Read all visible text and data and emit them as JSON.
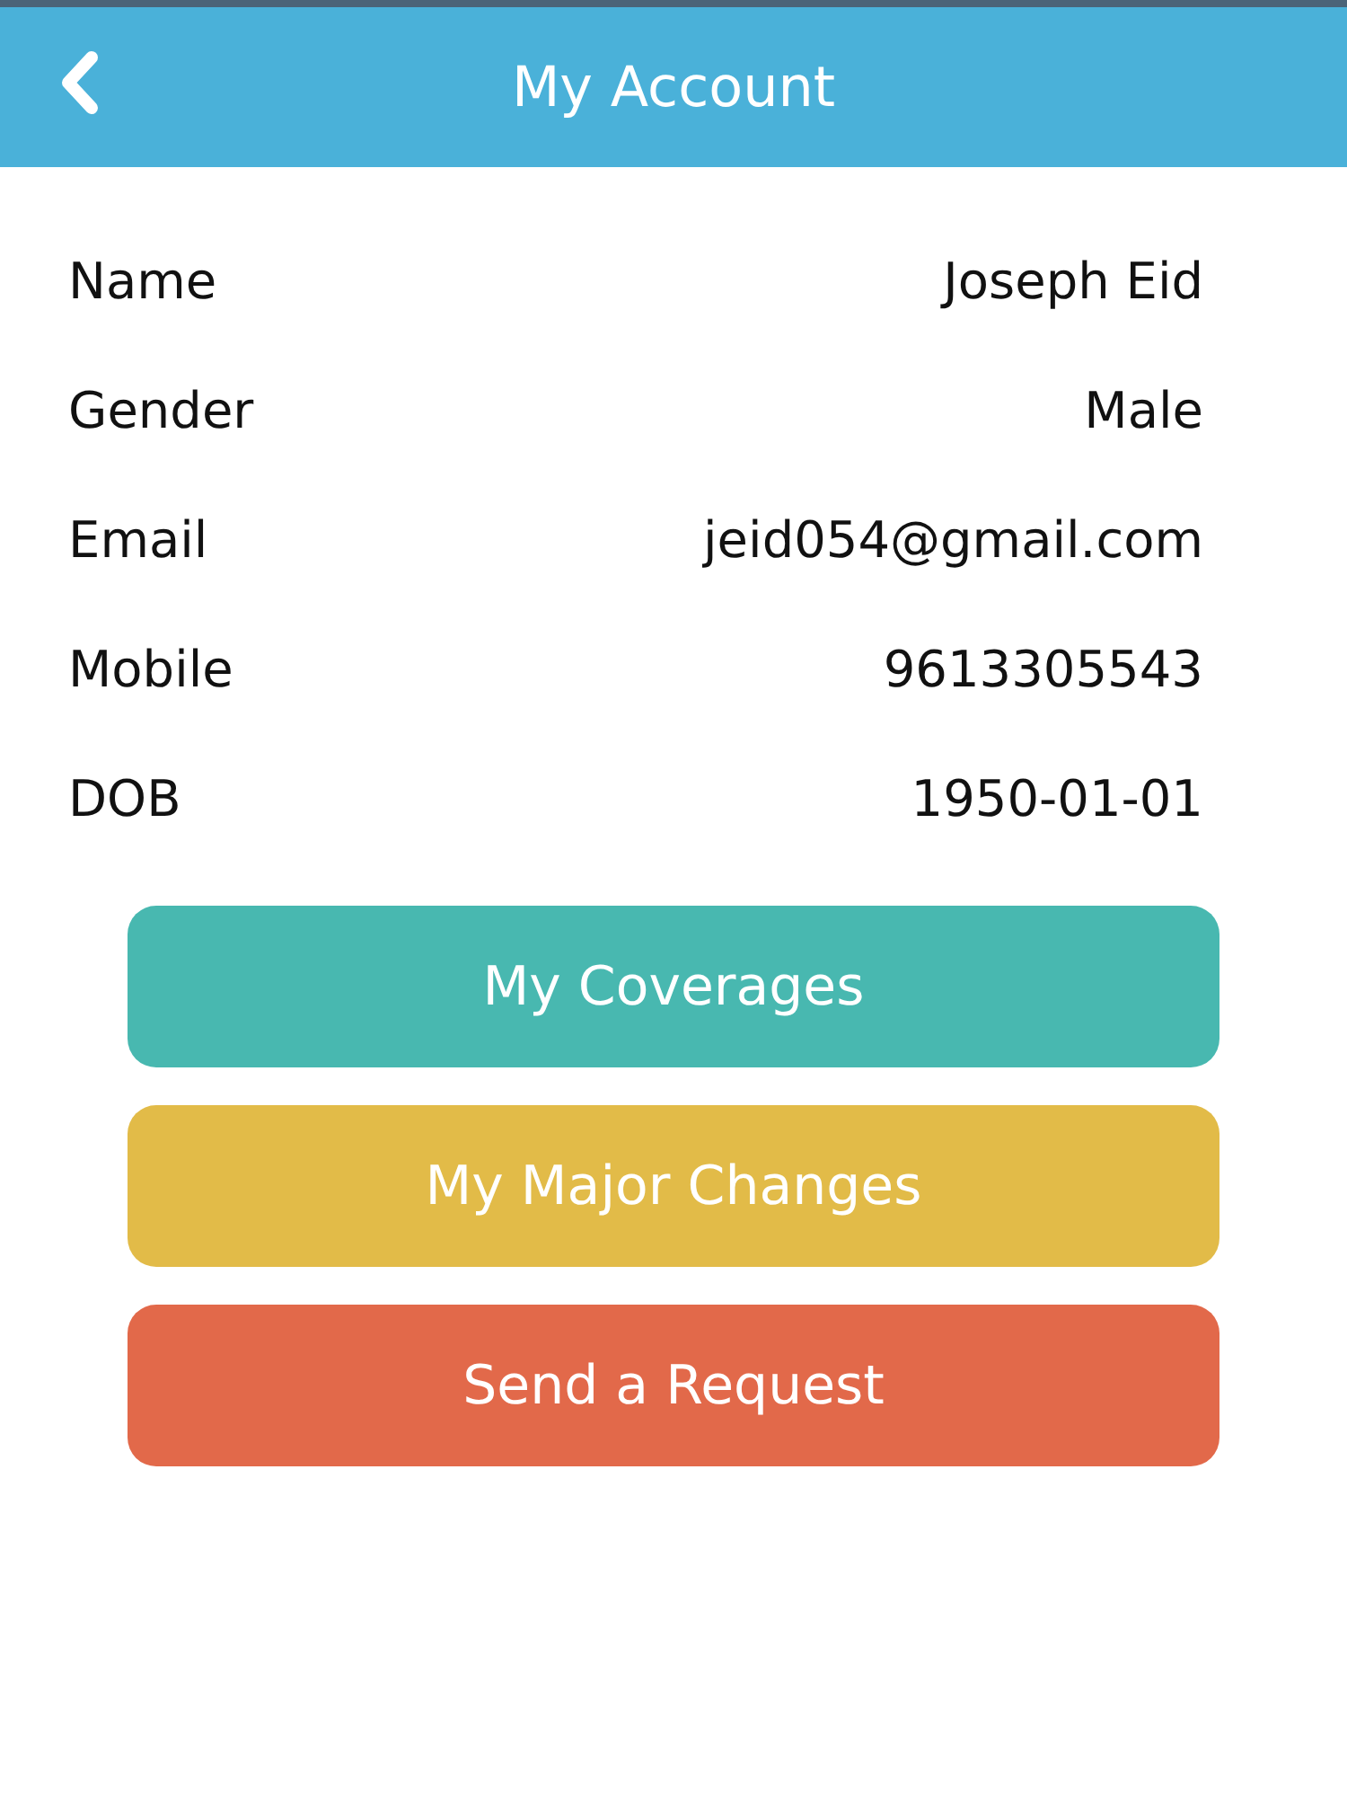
{
  "header": {
    "title": "My Account"
  },
  "fields": [
    {
      "label": "Name",
      "value": "Joseph Eid"
    },
    {
      "label": "Gender",
      "value": "Male"
    },
    {
      "label": "Email",
      "value": "jeid054@gmail.com"
    },
    {
      "label": "Mobile",
      "value": "9613305543"
    },
    {
      "label": "DOB",
      "value": "1950-01-01"
    }
  ],
  "buttons": [
    {
      "label": "My Coverages",
      "color": "#48b8b0"
    },
    {
      "label": "My Major Changes",
      "color": "#e2bb48"
    },
    {
      "label": "Send a Request",
      "color": "#e2694a"
    }
  ]
}
